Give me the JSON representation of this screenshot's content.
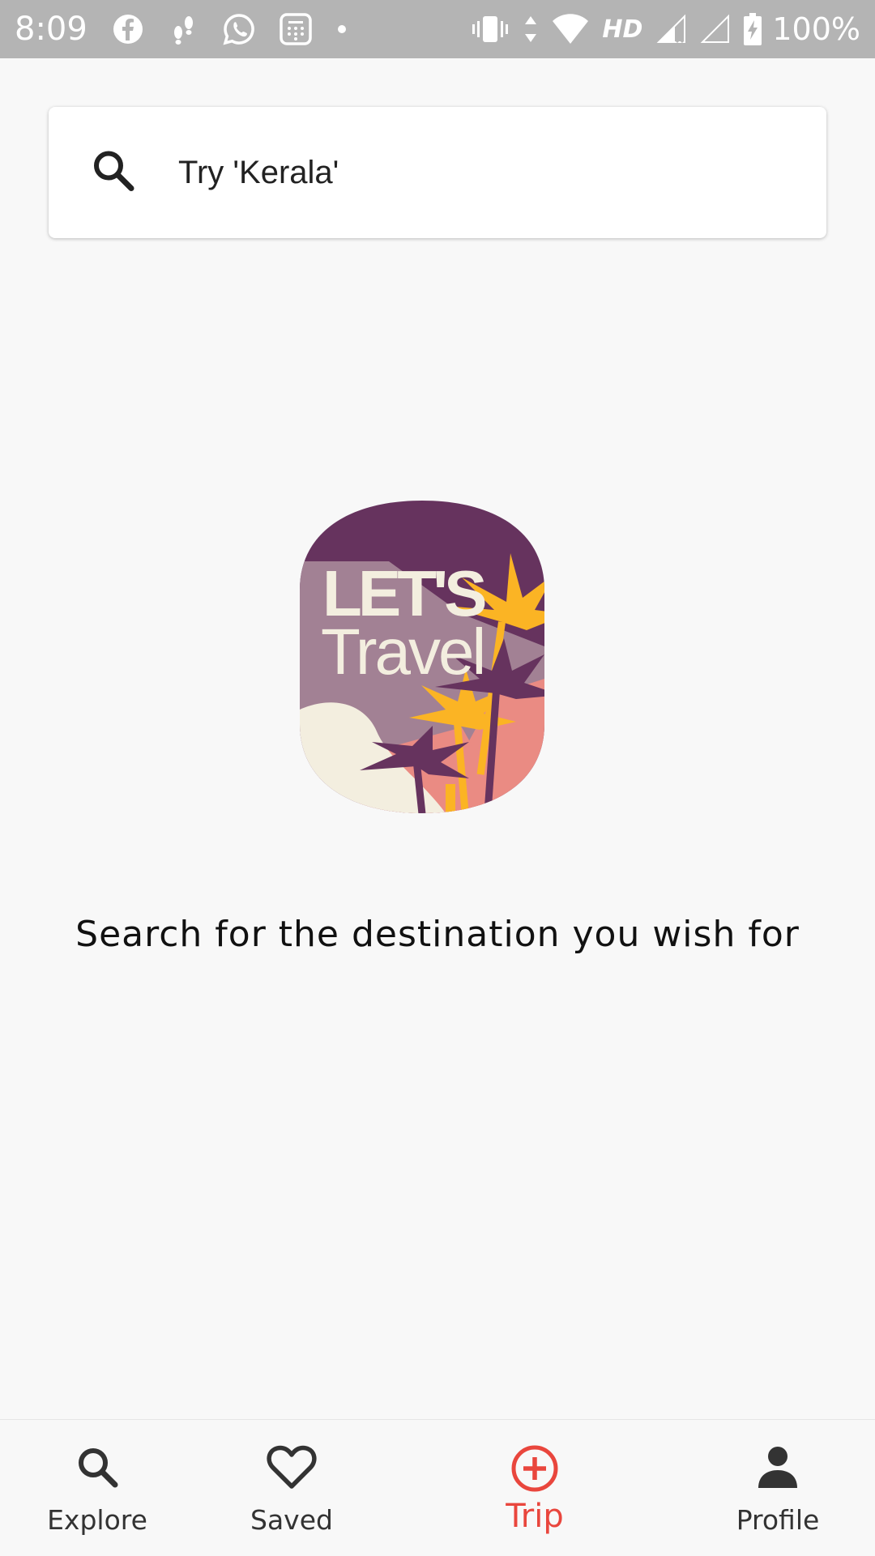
{
  "status_bar": {
    "time": "8:09",
    "network": "HD",
    "battery": "100%"
  },
  "search": {
    "placeholder": "Try 'Kerala'",
    "icon": "search-icon"
  },
  "illustration": {
    "line1": "LET'S",
    "line2": "Travel",
    "colors": {
      "sky": "#66335e",
      "mountain": "#a28194",
      "sand": "#f3eedf",
      "palm_yellow": "#fbb424",
      "palm_purple": "#66335e",
      "sunset": "#ea8b83"
    }
  },
  "hint": "Search for the destination you wish for",
  "bottom_nav": {
    "items": [
      {
        "label": "Explore",
        "icon": "search-icon",
        "active": false
      },
      {
        "label": "Saved",
        "icon": "heart-icon",
        "active": false
      },
      {
        "label": "Trip",
        "icon": "add-circle-icon",
        "active": true
      },
      {
        "label": "Profile",
        "icon": "person-icon",
        "active": false
      }
    ],
    "active_color": "#e9463d"
  }
}
